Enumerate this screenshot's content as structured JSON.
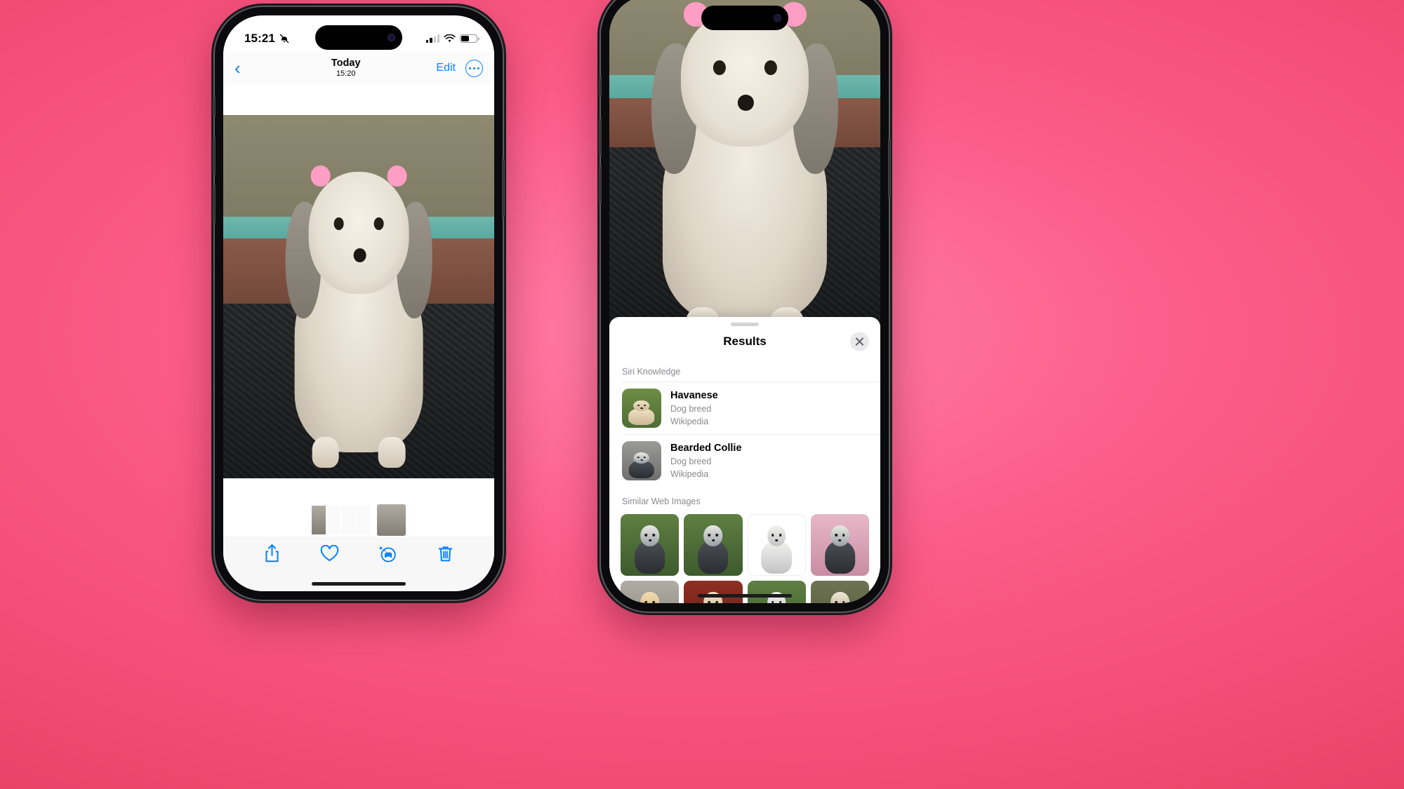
{
  "theme": {
    "background_pink": "#F04A72",
    "accent_blue": "#0A84FF",
    "sheet_bg": "#FFFFFF"
  },
  "left_phone": {
    "status_bar": {
      "time": "15:21",
      "silent_icon": "bell-slash-icon",
      "signal_icon": "cellular-signal-icon",
      "wifi_icon": "wifi-icon",
      "battery_icon": "battery-icon",
      "battery_level": "50"
    },
    "nav": {
      "back_icon": "chevron-left-icon",
      "title": "Today",
      "subtitle": "15:20",
      "edit_label": "Edit",
      "more_icon": "ellipsis-circle-icon"
    },
    "toolbar": {
      "share_icon": "share-icon",
      "favorite_icon": "heart-icon",
      "visual_lookup_icon": "visual-look-up-dog-icon",
      "delete_icon": "trash-icon"
    }
  },
  "right_phone": {
    "sheet": {
      "grabber": "sheet-grabber",
      "title": "Results",
      "close_icon": "close-x-icon",
      "sections": [
        {
          "header": "Siri Knowledge",
          "rows": [
            {
              "title": "Havanese",
              "subtitle": "Dog breed",
              "source": "Wikipedia",
              "thumb": "havanese-thumbnail"
            },
            {
              "title": "Bearded Collie",
              "subtitle": "Dog breed",
              "source": "Wikipedia",
              "thumb": "bearded-collie-thumbnail"
            }
          ]
        },
        {
          "header": "Similar Web Images",
          "images": [
            {
              "name": "web-image-1"
            },
            {
              "name": "web-image-2"
            },
            {
              "name": "web-image-3"
            },
            {
              "name": "web-image-4"
            },
            {
              "name": "web-image-5"
            },
            {
              "name": "web-image-6"
            },
            {
              "name": "web-image-7"
            },
            {
              "name": "web-image-8"
            }
          ]
        }
      ]
    }
  }
}
